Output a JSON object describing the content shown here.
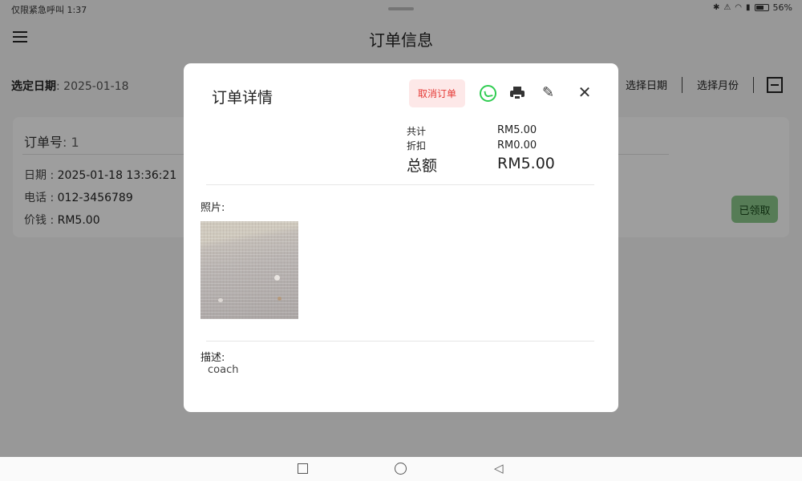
{
  "status_bar": {
    "left_text": "仅限紧急呼叫 1:37",
    "battery_percent": "56%",
    "battery_level": 0.56
  },
  "app": {
    "title": "订单信息"
  },
  "toolbar": {
    "date_label": "选定日期",
    "date_value": ": 2025-01-18",
    "select_date": "选择日期",
    "select_month": "选择月份"
  },
  "order_card": {
    "order_no_label": "订单号",
    "order_no_value": ": 1",
    "date_label": "日期 : ",
    "date_value": "2025-01-18 13:36:21",
    "phone_label": "电话 : ",
    "phone_value": "012-3456789",
    "price_label": "价钱 : ",
    "price_value": "RM5.00",
    "pickup_button": "已领取"
  },
  "dialog": {
    "title": "订单详情",
    "cancel_order": "取消订单",
    "subtotal_label": "共计",
    "subtotal_value": "RM5.00",
    "discount_label": "折扣",
    "discount_value": "RM0.00",
    "total_label": "总额",
    "total_value": "RM5.00",
    "photo_label": "照片:",
    "description_label": "描述:",
    "description_value": "coach"
  },
  "icons": {
    "menu": "menu-icon",
    "scan": "scan-icon",
    "whatsapp": "whatsapp-icon",
    "print": "print-icon",
    "edit": "edit-icon",
    "close": "close-icon"
  },
  "colors": {
    "cancel_text": "#e53935",
    "cancel_bg": "#fde8e8",
    "pickup_bg": "#8bc98c",
    "whatsapp": "#2ecc50"
  }
}
